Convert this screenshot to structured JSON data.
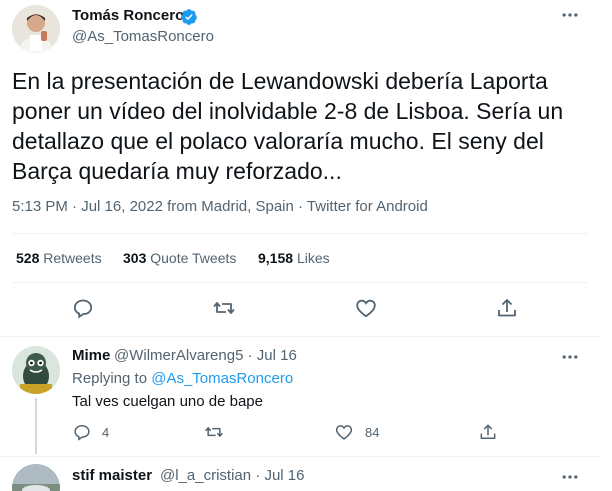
{
  "tweet": {
    "author_name": "Tomás Roncero",
    "author_handle": "@As_TomasRoncero",
    "verified_icon": "verified-badge-icon",
    "text": "En la presentación de Lewandowski debería Laporta poner un vídeo del inolvidable 2-8 de Lisboa. Sería un detallazo que el polaco valoraría mucho. El seny del Barça quedaría muy reforzado...",
    "time": "5:13 PM",
    "date": "Jul 16, 2022",
    "location": "from Madrid, Spain",
    "source": "Twitter for Android",
    "meta_separator": "·",
    "stats": {
      "retweets_count": "528",
      "retweets_label": "Retweets",
      "quote_count": "303",
      "quote_label": "Quote Tweets",
      "likes_count": "9,158",
      "likes_label": "Likes"
    }
  },
  "replies": [
    {
      "name": "Mime",
      "handle": "@WilmerAlvareng5",
      "date": "Jul 16",
      "replying_label": "Replying to",
      "replying_to": "@As_TomasRoncero",
      "text": "Tal ves cuelgan uno de bape",
      "reply_count": "4",
      "retweet_count": "",
      "like_count": "84"
    },
    {
      "name": "stif maister",
      "handle": "@l_a_cristian",
      "date": "Jul 16"
    }
  ],
  "colors": {
    "accent": "#1d9bf0",
    "secondary_text": "#536471",
    "primary_text": "#0f1419",
    "divider": "#eff3f4"
  },
  "icons": [
    "more-icon",
    "reply-icon",
    "retweet-icon",
    "like-icon",
    "share-icon",
    "verified-badge-icon"
  ]
}
